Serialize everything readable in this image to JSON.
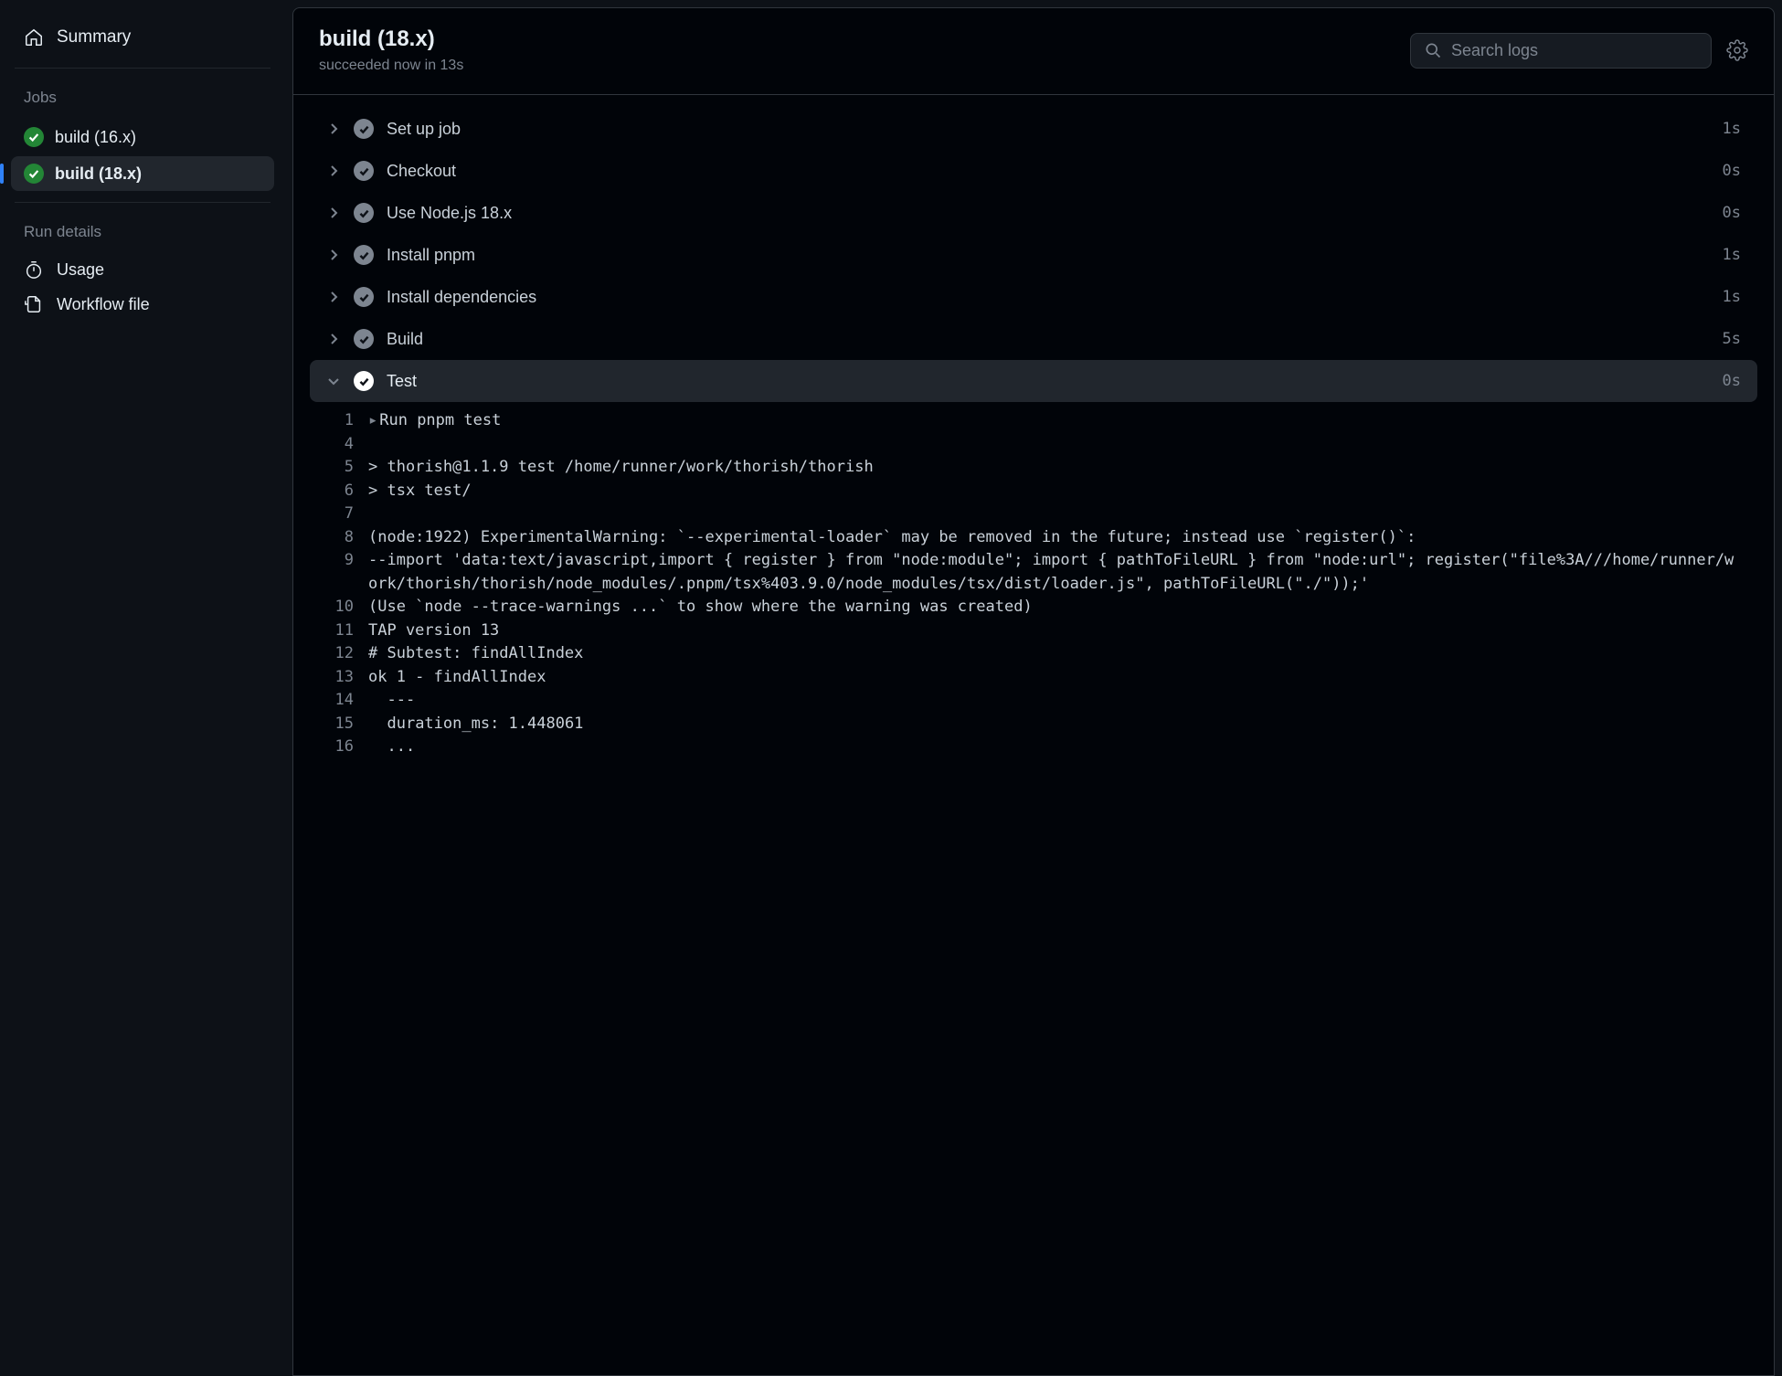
{
  "sidebar": {
    "summary_label": "Summary",
    "jobs_header": "Jobs",
    "jobs": [
      {
        "label": "build (16.x)",
        "active": false
      },
      {
        "label": "build (18.x)",
        "active": true
      }
    ],
    "run_details_header": "Run details",
    "details": [
      {
        "label": "Usage",
        "icon": "timer"
      },
      {
        "label": "Workflow file",
        "icon": "file"
      }
    ]
  },
  "header": {
    "title": "build (18.x)",
    "subtitle": "succeeded now in 13s",
    "search_placeholder": "Search logs"
  },
  "steps": [
    {
      "name": "Set up job",
      "time": "1s",
      "expanded": false
    },
    {
      "name": "Checkout",
      "time": "0s",
      "expanded": false
    },
    {
      "name": "Use Node.js 18.x",
      "time": "0s",
      "expanded": false
    },
    {
      "name": "Install pnpm",
      "time": "1s",
      "expanded": false
    },
    {
      "name": "Install dependencies",
      "time": "1s",
      "expanded": false
    },
    {
      "name": "Build",
      "time": "5s",
      "expanded": false
    },
    {
      "name": "Test",
      "time": "0s",
      "expanded": true
    }
  ],
  "log_lines": [
    {
      "n": "1",
      "t": "Run pnpm test",
      "caret": true
    },
    {
      "n": "4",
      "t": ""
    },
    {
      "n": "5",
      "t": "> thorish@1.1.9 test /home/runner/work/thorish/thorish"
    },
    {
      "n": "6",
      "t": "> tsx test/"
    },
    {
      "n": "7",
      "t": ""
    },
    {
      "n": "8",
      "t": "(node:1922) ExperimentalWarning: `--experimental-loader` may be removed in the future; instead use `register()`:"
    },
    {
      "n": "9",
      "t": "--import 'data:text/javascript,import { register } from \"node:module\"; import { pathToFileURL } from \"node:url\"; register(\"file%3A///home/runner/work/thorish/thorish/node_modules/.pnpm/tsx%403.9.0/node_modules/tsx/dist/loader.js\", pathToFileURL(\"./\"));'"
    },
    {
      "n": "10",
      "t": "(Use `node --trace-warnings ...` to show where the warning was created)"
    },
    {
      "n": "11",
      "t": "TAP version 13"
    },
    {
      "n": "12",
      "t": "# Subtest: findAllIndex"
    },
    {
      "n": "13",
      "t": "ok 1 - findAllIndex"
    },
    {
      "n": "14",
      "t": "  ---"
    },
    {
      "n": "15",
      "t": "  duration_ms: 1.448061"
    },
    {
      "n": "16",
      "t": "  ..."
    }
  ]
}
